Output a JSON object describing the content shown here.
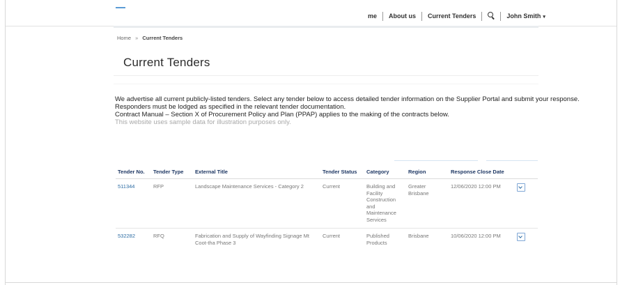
{
  "nav": {
    "home_label": "me",
    "about_label": "About us",
    "tenders_label": "Current Tenders",
    "user_name": "John Smith",
    "user_caret": "▾"
  },
  "breadcrumb": {
    "home": "Home",
    "separator": "»",
    "current": "Current Tenders"
  },
  "page": {
    "title": "Current Tenders"
  },
  "intro": {
    "line1": "We advertise all current publicly-listed tenders. Select any tender below to access detailed tender information on the Supplier Portal and submit your response.",
    "line2": "Responders must be lodged as specified in the relevant tender documentation.",
    "line3": "Contract Manual – Section X of Procurement Policy and Plan (PPAP) applies to the making of the contracts below.",
    "line4": "This website uses sample data for illustration purposes only."
  },
  "table": {
    "headers": {
      "tender_no": "Tender No.",
      "tender_type": "Tender Type",
      "external_title": "External Title",
      "tender_status": "Tender Status",
      "category": "Category",
      "region": "Region",
      "response_close_date": "Response Close Date"
    },
    "rows": [
      {
        "tender_no": "511344",
        "tender_type": "RFP",
        "external_title": "Landscape Maintenance Services - Category 2",
        "tender_status": "Current",
        "category": "Building and Facility Construction and Maintenance Services",
        "region": "Greater Brisbane",
        "response_close_date": "12/06/2020 12:00 PM"
      },
      {
        "tender_no": "532282",
        "tender_type": "RFQ",
        "external_title": "Fabrication and Supply of Wayfinding Signage Mt Coot-tha Phase 3",
        "tender_status": "Current",
        "category": "Published Products",
        "region": "Brisbane",
        "response_close_date": "10/06/2020 12:00 PM"
      }
    ]
  },
  "colors": {
    "link": "#2e6da4",
    "header_text": "#1f3864",
    "accent": "#5b9bd5"
  },
  "icons": {
    "search": "search-icon",
    "expand": "chevron-down-icon"
  }
}
